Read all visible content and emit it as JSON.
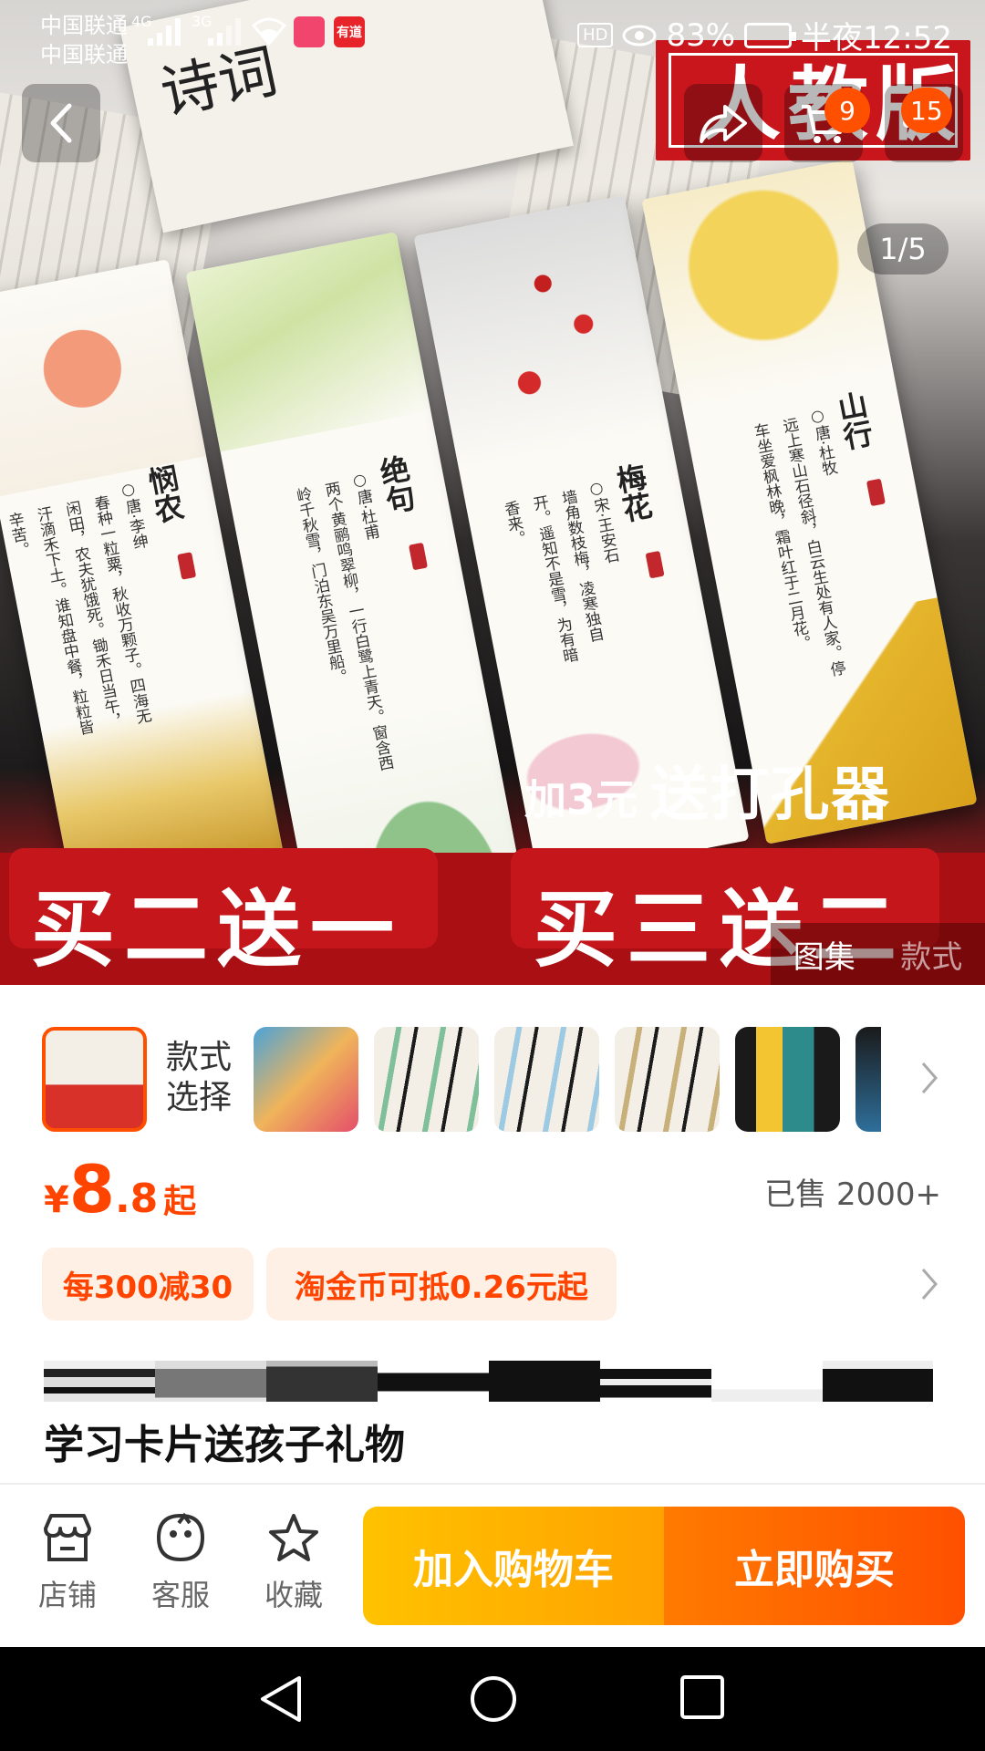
{
  "status_bar": {
    "carrier_1": "中国联通",
    "carrier_2": "中国联通",
    "signal_1": "4G",
    "signal_2": "3G",
    "app_badge_1": "",
    "app_badge_2": "有道",
    "hd": "HD",
    "battery": "83%",
    "time": "半夜12:52"
  },
  "gallery": {
    "counter": "1/5",
    "edition_label": "人教版",
    "book_title": "诗词",
    "promo_small_a": "加3元",
    "promo_small_b": "送打孔器",
    "banner_left": "买二送一",
    "banner_right": "买三送二",
    "tab_active": "图集",
    "tab_inactive": "款式",
    "cards": [
      {
        "title": "悯农",
        "author": "○唐·李绅",
        "lines": [
          "春种一粒粟，秋收万颗子。",
          "四海无闲田，农夫犹饿死。",
          "锄禾日当午，汗滴禾下土。",
          "谁知盘中餐，粒粒皆辛苦。"
        ]
      },
      {
        "title": "绝句",
        "author": "○唐·杜甫",
        "lines": [
          "两个黄鹂鸣翠柳，一行白鹭上青天。",
          "窗含西岭千秋雪，门泊东吴万里船。"
        ]
      },
      {
        "title": "梅花",
        "author": "○宋·王安石",
        "lines": [
          "墙角数枝梅，凌寒独自开。",
          "遥知不是雪，为有暗香来。"
        ]
      },
      {
        "title": "山行",
        "author": "○唐·杜牧",
        "lines": [
          "远上寒山石径斜，白云生处有人家。",
          "停车坐爱枫林晚，霜叶红于二月花。"
        ]
      }
    ]
  },
  "header": {
    "cart_badge": "9",
    "more_badge": "15"
  },
  "style_select": {
    "label": "款式选择"
  },
  "price": {
    "currency": "¥",
    "integer": "8",
    "decimal": ".8",
    "suffix": "起",
    "sold": "已售 2000+"
  },
  "coupons": [
    "每300减30",
    "淘金币可抵0.26元起"
  ],
  "product_title": "学习卡片送孩子礼物",
  "bottom_bar": {
    "shop": "店铺",
    "service": "客服",
    "favorite": "收藏",
    "add_to_cart": "加入购物车",
    "buy_now": "立即购买"
  },
  "colors": {
    "accent": "#ff5000",
    "cart_button": "#ffb000",
    "price": "#ff4400",
    "banner_red": "#a90f13"
  }
}
